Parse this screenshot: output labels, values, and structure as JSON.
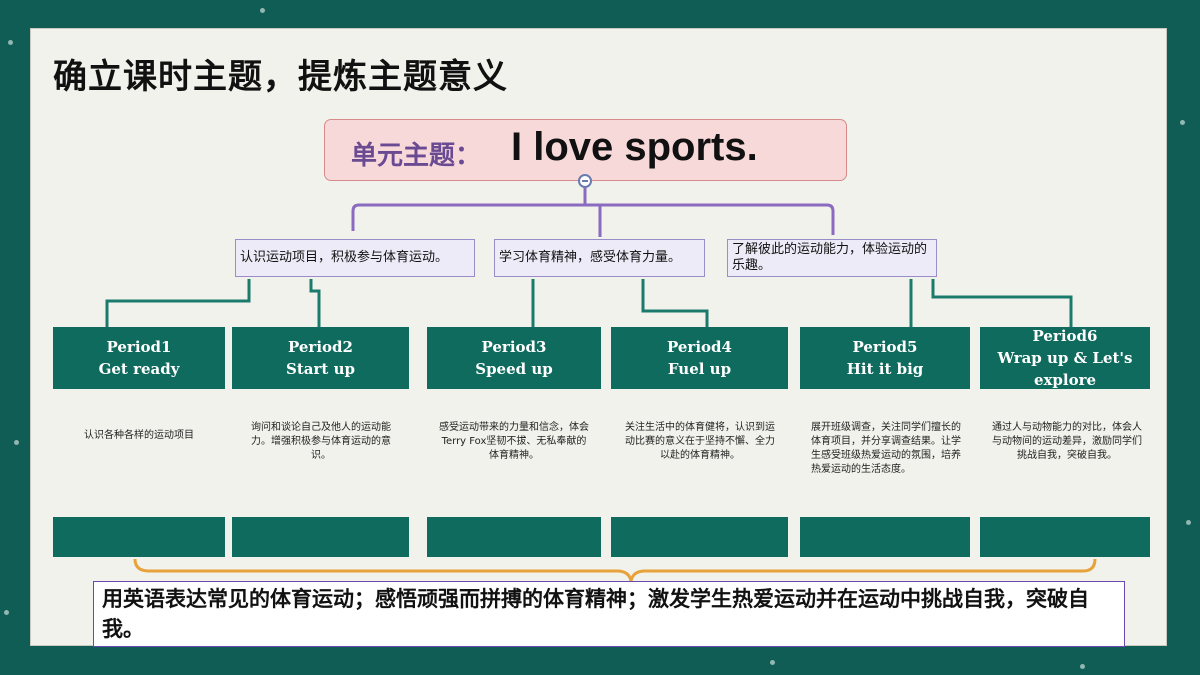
{
  "title": "确立课时主题，提炼主题意义",
  "unit_theme": {
    "label": "单元主题：",
    "value": "I love sports."
  },
  "goals": [
    "认识运动项目，积极参与体育运动。",
    "学习体育精神，感受体育力量。",
    "了解彼此的运动能力，体验运动的乐趣。"
  ],
  "periods": [
    {
      "num": "Period1",
      "name": "Get ready",
      "desc": "认识各种各样的运动项目"
    },
    {
      "num": "Period2",
      "name": "Start up",
      "desc": "询问和谈论自己及他人的运动能力。增强积极参与体育运动的意识。"
    },
    {
      "num": "Period3",
      "name": "Speed up",
      "desc": "感受运动带来的力量和信念，体会Terry Fox坚韧不拔、无私奉献的体育精神。"
    },
    {
      "num": "Period4",
      "name": "Fuel up",
      "desc": "关注生活中的体育健将，认识到运动比赛的意义在于坚持不懈、全力以赴的体育精神。"
    },
    {
      "num": "Period5",
      "name": "Hit it big",
      "desc": "展开班级调查，关注同学们擅长的体育项目，并分享调查结果。让学生感受班级热爱运动的氛围，培养热爱运动的生活态度。"
    },
    {
      "num": "Period6",
      "name": "Wrap up & Let's explore",
      "desc": "通过人与动物能力的对比，体会人与动物间的运动差异，激励同学们挑战自我，突破自我。"
    }
  ],
  "summary": "用英语表达常见的体育运动；感悟顽强而拼搏的体育精神；激发学生热爱运动并在运动中挑战自我，突破自我。",
  "colors": {
    "background": "#0f5d54",
    "period": "#0f6b5e",
    "connector_purple": "#8a6bbf",
    "connector_green": "#1a7a6c",
    "brace": "#e8a23a"
  }
}
